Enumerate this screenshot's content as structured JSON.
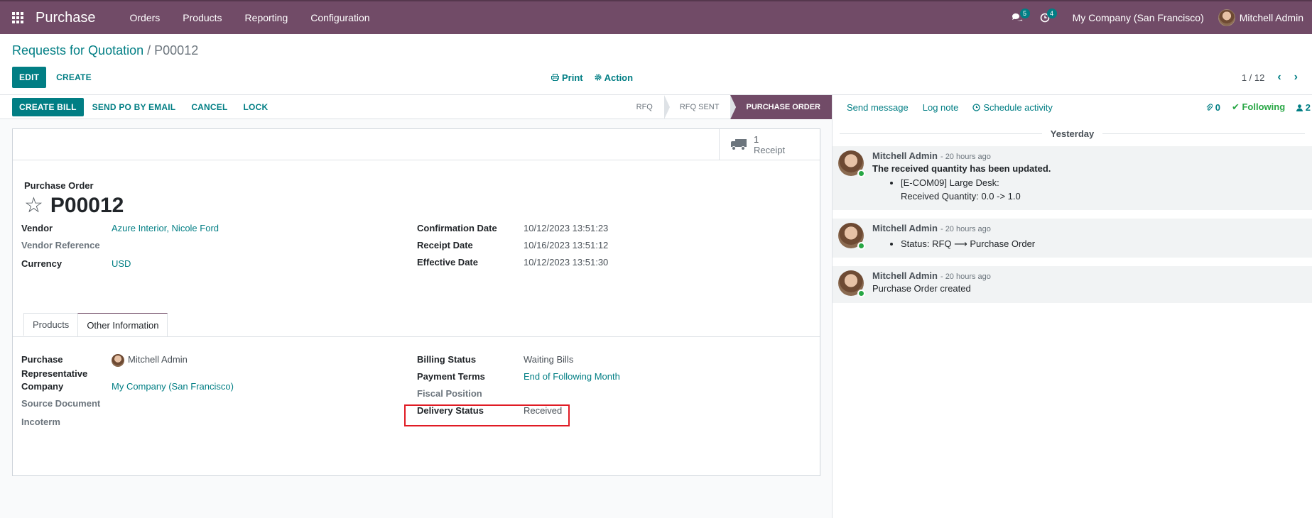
{
  "navbar": {
    "brand": "Purchase",
    "menu": [
      "Orders",
      "Products",
      "Reporting",
      "Configuration"
    ],
    "messages_count": "5",
    "activities_count": "4",
    "company": "My Company (San Francisco)",
    "user": "Mitchell Admin"
  },
  "control_panel": {
    "breadcrumb_parent": "Requests for Quotation",
    "breadcrumb_sep": "/",
    "breadcrumb_current": "P00012",
    "edit_label": "EDIT",
    "create_label": "CREATE",
    "print_label": "Print",
    "action_label": "Action",
    "pager_value": "1 / 12"
  },
  "statusbar": {
    "create_bill": "CREATE BILL",
    "send_po": "SEND PO BY EMAIL",
    "cancel": "CANCEL",
    "lock": "LOCK",
    "stages": [
      "RFQ",
      "RFQ SENT",
      "PURCHASE ORDER"
    ],
    "active_stage": "PURCHASE ORDER"
  },
  "smart_button": {
    "count": "1",
    "label": "Receipt"
  },
  "form": {
    "title_label": "Purchase Order",
    "name": "P00012",
    "vendor_label": "Vendor",
    "vendor": "Azure Interior, Nicole Ford",
    "vendor_ref_label": "Vendor Reference",
    "currency_label": "Currency",
    "currency": "USD",
    "confirmation_date_label": "Confirmation Date",
    "confirmation_date": "10/12/2023 13:51:23",
    "receipt_date_label": "Receipt Date",
    "receipt_date": "10/16/2023 13:51:12",
    "effective_date_label": "Effective Date",
    "effective_date": "10/12/2023 13:51:30",
    "tabs": [
      "Products",
      "Other Information"
    ],
    "active_tab": "Other Information",
    "rep_label_1": "Purchase",
    "rep_label_2": "Representative",
    "rep": "Mitchell Admin",
    "company_label": "Company",
    "company": "My Company (San Francisco)",
    "source_doc_label": "Source Document",
    "incoterm_label": "Incoterm",
    "billing_status_label": "Billing Status",
    "billing_status": "Waiting Bills",
    "payment_terms_label": "Payment Terms",
    "payment_terms": "End of Following Month",
    "fiscal_position_label": "Fiscal Position",
    "delivery_status_label": "Delivery Status",
    "delivery_status": "Received"
  },
  "chatter": {
    "send_message": "Send message",
    "log_note": "Log note",
    "schedule_activity": "Schedule activity",
    "attachments": "0",
    "following": "Following",
    "followers": "2",
    "divider": "Yesterday",
    "messages": [
      {
        "author": "Mitchell Admin",
        "date": "- 20 hours ago",
        "title": "The received quantity has been updated.",
        "items": [
          "[E-COM09] Large Desk:",
          "Received Quantity: 0.0 -> 1.0"
        ]
      },
      {
        "author": "Mitchell Admin",
        "date": "- 20 hours ago",
        "items": [
          "Status: RFQ ⟶ Purchase Order"
        ]
      },
      {
        "author": "Mitchell Admin",
        "date": "- 20 hours ago",
        "text": "Purchase Order created"
      }
    ]
  }
}
